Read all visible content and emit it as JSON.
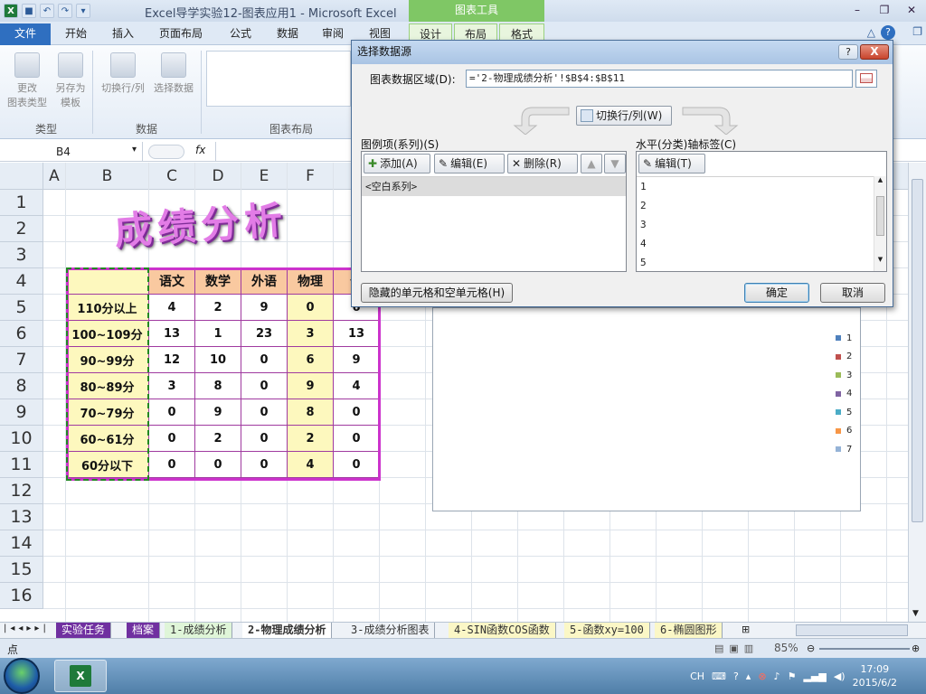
{
  "window": {
    "title": "Excel导学实验12-图表应用1 - Microsoft Excel",
    "context_tab_header": "图表工具"
  },
  "ribbon_tabs": [
    "文件",
    "开始",
    "插入",
    "页面布局",
    "公式",
    "数据",
    "审阅",
    "视图",
    "设计",
    "布局",
    "格式"
  ],
  "ribbon": {
    "change_type": "更改\n图表类型",
    "save_template": "另存为\n模板",
    "switch_row_col": "切换行/列",
    "select_data": "选择数据",
    "group_type": "类型",
    "group_data": "数据",
    "group_layout": "图表布局"
  },
  "formula_bar": {
    "name_box": "B4",
    "fx": "fx",
    "formula": ""
  },
  "sheet": {
    "columns": [
      "A",
      "B",
      "C",
      "D",
      "E",
      "F"
    ],
    "rows": [
      "1",
      "2",
      "3",
      "4",
      "5",
      "6",
      "7",
      "8",
      "9",
      "10",
      "11",
      "12",
      "13",
      "14",
      "15",
      "16"
    ],
    "wordart_title": "成绩分析",
    "table_headers": [
      "语文",
      "数学",
      "外语",
      "物理",
      "化"
    ],
    "table_rows": [
      {
        "label": "110分以上",
        "values": [
          "4",
          "2",
          "9",
          "0",
          "6"
        ]
      },
      {
        "label": "100~109分",
        "values": [
          "13",
          "1",
          "23",
          "3",
          "13"
        ]
      },
      {
        "label": "90~99分",
        "values": [
          "12",
          "10",
          "0",
          "6",
          "9"
        ]
      },
      {
        "label": "80~89分",
        "values": [
          "3",
          "8",
          "0",
          "9",
          "4"
        ]
      },
      {
        "label": "70~79分",
        "values": [
          "0",
          "9",
          "0",
          "8",
          "0"
        ]
      },
      {
        "label": "60~61分",
        "values": [
          "0",
          "2",
          "0",
          "2",
          "0"
        ]
      },
      {
        "label": "60分以下",
        "values": [
          "0",
          "0",
          "0",
          "4",
          "0"
        ]
      }
    ]
  },
  "chart_legend": [
    {
      "label": "1",
      "color": "#4f81bd"
    },
    {
      "label": "2",
      "color": "#c0504d"
    },
    {
      "label": "3",
      "color": "#9bbb59"
    },
    {
      "label": "4",
      "color": "#8064a2"
    },
    {
      "label": "5",
      "color": "#4bacc6"
    },
    {
      "label": "6",
      "color": "#f79646"
    },
    {
      "label": "7",
      "color": "#95b3d7"
    }
  ],
  "sheet_tabs": [
    "实验任务",
    "档案",
    "1-成绩分析",
    "2-物理成绩分析",
    "3-成绩分析图表",
    "4-SIN函数COS函数",
    "5-函数xy=100",
    "6-椭圆图形"
  ],
  "status": {
    "mode": "点",
    "zoom": "85%"
  },
  "taskbar": {
    "lang": "CH",
    "time": "17:09",
    "date": "2015/6/2"
  },
  "dialog": {
    "title": "选择数据源",
    "help_label": "?",
    "close_label": "X",
    "range_label": "图表数据区域(D):",
    "range_value": "='2-物理成绩分析'!$B$4:$B$11",
    "switch_label": "切换行/列(W)",
    "series_label": "图例项(系列)(S)",
    "axis_label": "水平(分类)轴标签(C)",
    "add_label": "添加(A)",
    "edit_label": "编辑(E)",
    "delete_label": "删除(R)",
    "axis_edit_label": "编辑(T)",
    "series_items": [
      "<空白系列>"
    ],
    "axis_items": [
      "1",
      "2",
      "3",
      "4",
      "5"
    ],
    "hidden_cells_label": "隐藏的单元格和空单元格(H)",
    "ok_label": "确定",
    "cancel_label": "取消"
  }
}
